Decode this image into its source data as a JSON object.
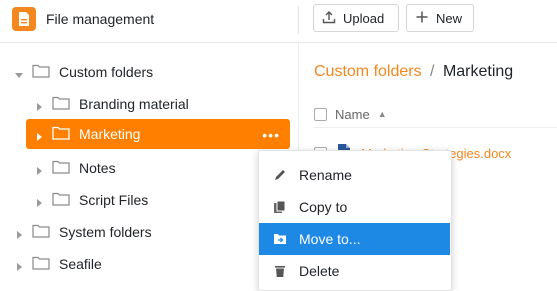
{
  "header": {
    "app_title": "File management",
    "upload_label": "Upload",
    "new_label": "New",
    "icons": {
      "app": "document-icon",
      "upload": "upload-icon",
      "new": "plus-icon"
    }
  },
  "sidebar": {
    "items": [
      {
        "label": "Custom folders",
        "expanded": true,
        "level": 0
      },
      {
        "label": "Branding material",
        "expanded": false,
        "level": 1
      },
      {
        "label": "Marketing",
        "expanded": false,
        "level": 1,
        "active": true
      },
      {
        "label": "Notes",
        "expanded": false,
        "level": 1
      },
      {
        "label": "Script Files",
        "expanded": false,
        "level": 1
      },
      {
        "label": "System folders",
        "expanded": false,
        "level": 0
      },
      {
        "label": "Seafile",
        "expanded": false,
        "level": 0
      }
    ],
    "active_more": "•••"
  },
  "main": {
    "breadcrumb": {
      "parent": "Custom folders",
      "separator": "/",
      "current": "Marketing"
    },
    "list_header": {
      "name_label": "Name",
      "sort_indicator": "▲"
    },
    "files": [
      {
        "name": "Marketing Strategies.docx"
      }
    ]
  },
  "context_menu": {
    "items": [
      {
        "label": "Rename",
        "icon": "pencil-icon"
      },
      {
        "label": "Copy to",
        "icon": "copy-icon"
      },
      {
        "label": "Move to...",
        "icon": "move-icon",
        "selected": true
      },
      {
        "label": "Delete",
        "icon": "trash-icon"
      }
    ]
  },
  "colors": {
    "accent_orange": "#ff8000",
    "link_orange": "#f5871f",
    "menu_selected_blue": "#1e88e5"
  }
}
